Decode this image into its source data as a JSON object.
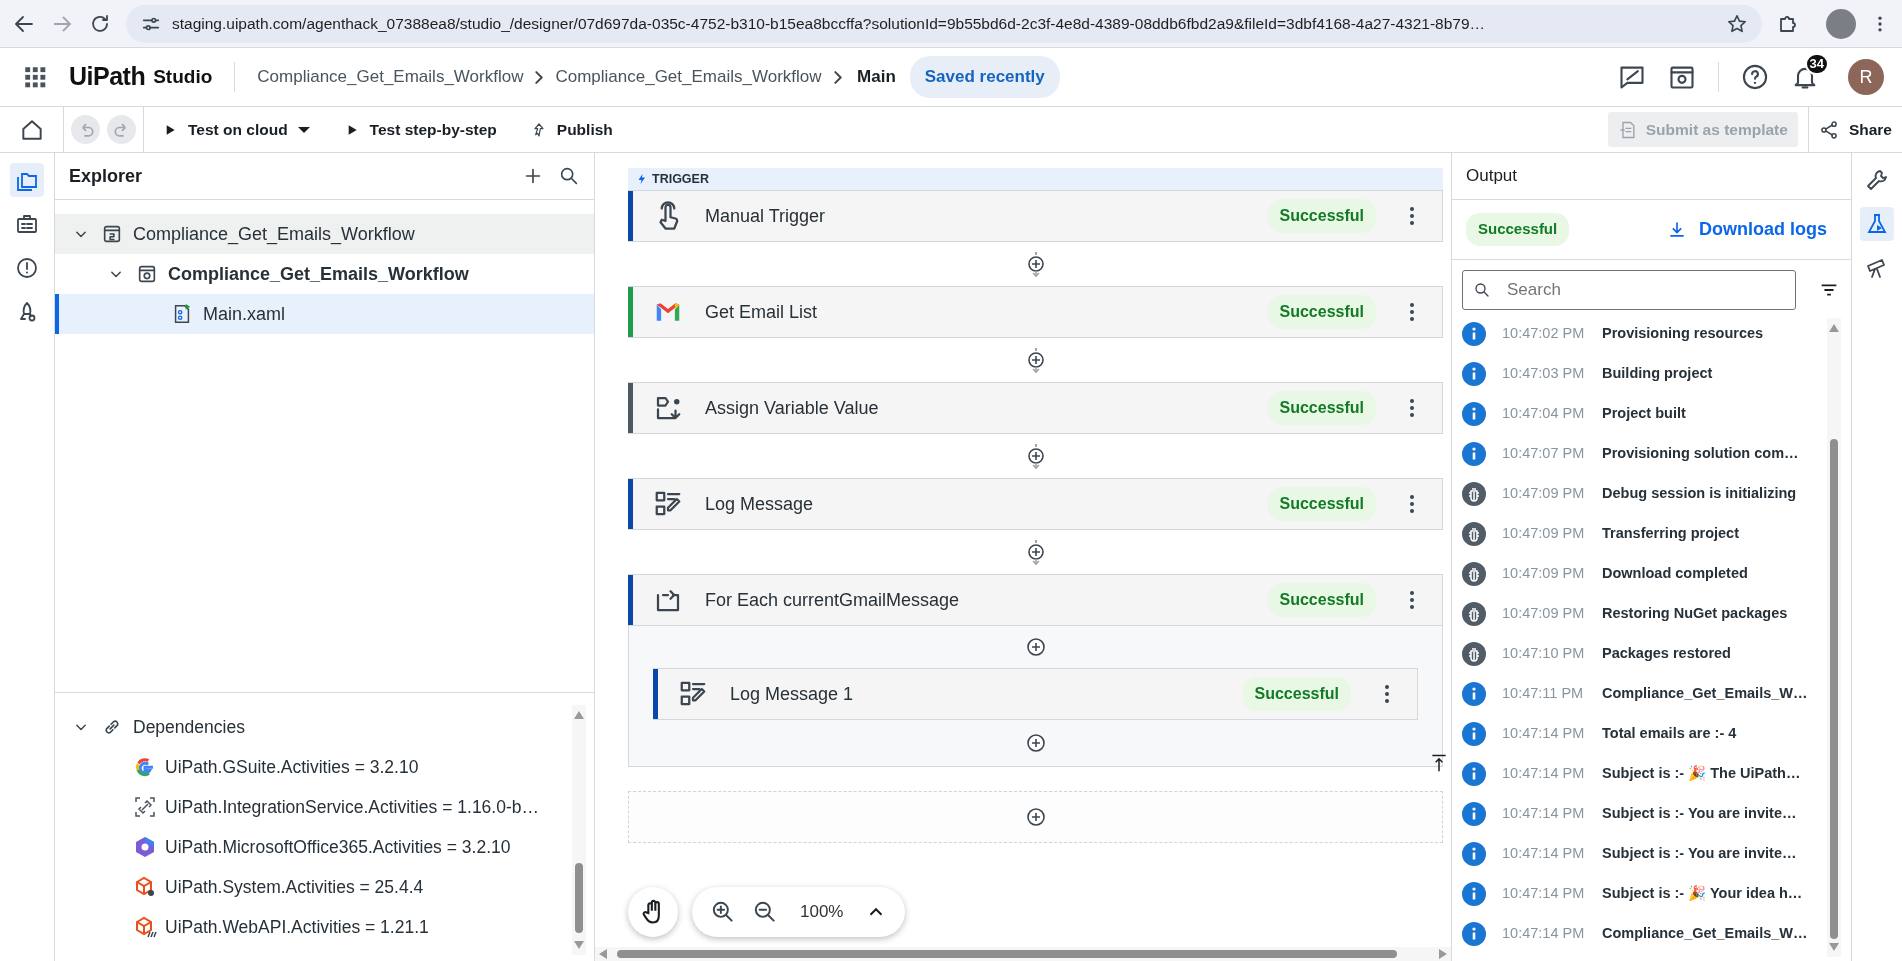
{
  "browser": {
    "url": "staging.uipath.com/agenthack_07388ea8/studio_/designer/07d697da-035c-4752-b310-b15ea8bccffa?solutionId=9b55bd6d-2c3f-4e8d-4389-08ddb6fbd2a9&fileId=3dbf4168-4a27-4321-8b79…"
  },
  "header": {
    "logo": "UiPath",
    "product": "Studio",
    "breadcrumbs": [
      "Compliance_Get_Emails_Workflow",
      "Compliance_Get_Emails_Workflow"
    ],
    "current": "Main",
    "save_status": "Saved recently",
    "notifications": "34",
    "avatar": "R"
  },
  "toolbar": {
    "undo_disabled": true,
    "redo_disabled": true,
    "actions": [
      {
        "label": "Test on cloud",
        "kind": "run",
        "dropdown": true
      },
      {
        "label": "Test step-by-step",
        "kind": "run",
        "dropdown": false
      },
      {
        "label": "Publish",
        "kind": "publish",
        "dropdown": false
      }
    ],
    "submit": {
      "label": "Submit as template",
      "disabled": true
    },
    "share": "Share"
  },
  "left_rail": [
    {
      "kind": "explorer",
      "selected": true
    },
    {
      "kind": "resources",
      "selected": false
    },
    {
      "kind": "errors",
      "selected": false
    },
    {
      "kind": "deploy",
      "selected": false
    }
  ],
  "explorer": {
    "title": "Explorer",
    "tree": [
      {
        "label": "Compliance_Get_Emails_Workflow",
        "kind": "solution",
        "expanded": true,
        "selected": false,
        "hovered": true,
        "children": [
          {
            "label": "Compliance_Get_Emails_Workflow",
            "kind": "project",
            "expanded": true,
            "selected": false,
            "children": [
              {
                "label": "Main.xaml",
                "kind": "file",
                "selected": true
              }
            ]
          }
        ]
      }
    ],
    "dependencies": {
      "label": "Dependencies",
      "expanded": true,
      "items": [
        {
          "label": "UiPath.GSuite.Activities = 3.2.10",
          "kind": "google"
        },
        {
          "label": "UiPath.IntegrationService.Activities = 1.16.0-b…",
          "kind": "integration"
        },
        {
          "label": "UiPath.MicrosoftOffice365.Activities = 3.2.10",
          "kind": "office"
        },
        {
          "label": "UiPath.System.Activities = 25.4.4",
          "kind": "system"
        },
        {
          "label": "UiPath.WebAPI.Activities = 1.21.1",
          "kind": "webapi"
        }
      ]
    }
  },
  "canvas": {
    "trigger_label": "TRIGGER",
    "activities": [
      {
        "title": "Manual Trigger",
        "kind": "trigger",
        "color": "#0b47a8",
        "status": "Successful"
      },
      {
        "title": "Get Email List",
        "kind": "gmail",
        "color": "#1e9e4a",
        "status": "Successful"
      },
      {
        "title": "Assign Variable Value",
        "kind": "assign",
        "color": "#4f5962",
        "status": "Successful"
      },
      {
        "title": "Log Message",
        "kind": "log",
        "color": "#0b47a8",
        "status": "Successful"
      },
      {
        "title": "For Each currentGmailMessage",
        "kind": "loop",
        "color": "#0b47a8",
        "status": "Successful",
        "children": [
          {
            "title": "Log Message 1",
            "kind": "log",
            "color": "#0b47a8",
            "status": "Successful"
          }
        ]
      }
    ],
    "zoom": "100%"
  },
  "output": {
    "title": "Output",
    "status": "Successful",
    "download": "Download logs",
    "search": {
      "placeholder": "Search"
    },
    "logs": [
      {
        "time": "10:47:02 PM",
        "message": "Provisioning resources",
        "kind": "info"
      },
      {
        "time": "10:47:03 PM",
        "message": "Building project",
        "kind": "info"
      },
      {
        "time": "10:47:04 PM",
        "message": "Project built",
        "kind": "info"
      },
      {
        "time": "10:47:07 PM",
        "message": "Provisioning solution com…",
        "kind": "info"
      },
      {
        "time": "10:47:09 PM",
        "message": "Debug session is initializing",
        "kind": "debug"
      },
      {
        "time": "10:47:09 PM",
        "message": "Transferring project",
        "kind": "debug"
      },
      {
        "time": "10:47:09 PM",
        "message": "Download completed",
        "kind": "debug"
      },
      {
        "time": "10:47:09 PM",
        "message": "Restoring NuGet packages",
        "kind": "debug"
      },
      {
        "time": "10:47:10 PM",
        "message": "Packages restored",
        "kind": "debug"
      },
      {
        "time": "10:47:11 PM",
        "message": "Compliance_Get_Emails_W…",
        "kind": "info"
      },
      {
        "time": "10:47:14 PM",
        "message": "Total emails are :- 4",
        "kind": "info"
      },
      {
        "time": "10:47:14 PM",
        "message": "Subject is :- 🎉 The UiPath…",
        "kind": "info"
      },
      {
        "time": "10:47:14 PM",
        "message": "Subject is :- You are invite…",
        "kind": "info"
      },
      {
        "time": "10:47:14 PM",
        "message": "Subject is :- You are invite…",
        "kind": "info"
      },
      {
        "time": "10:47:14 PM",
        "message": "Subject is :- 🎉 Your idea h…",
        "kind": "info"
      },
      {
        "time": "10:47:14 PM",
        "message": "Compliance_Get_Emails_W…",
        "kind": "info"
      }
    ]
  },
  "right_rail": [
    {
      "kind": "tools",
      "selected": false
    },
    {
      "kind": "test",
      "selected": true
    },
    {
      "kind": "explore",
      "selected": false
    }
  ]
}
